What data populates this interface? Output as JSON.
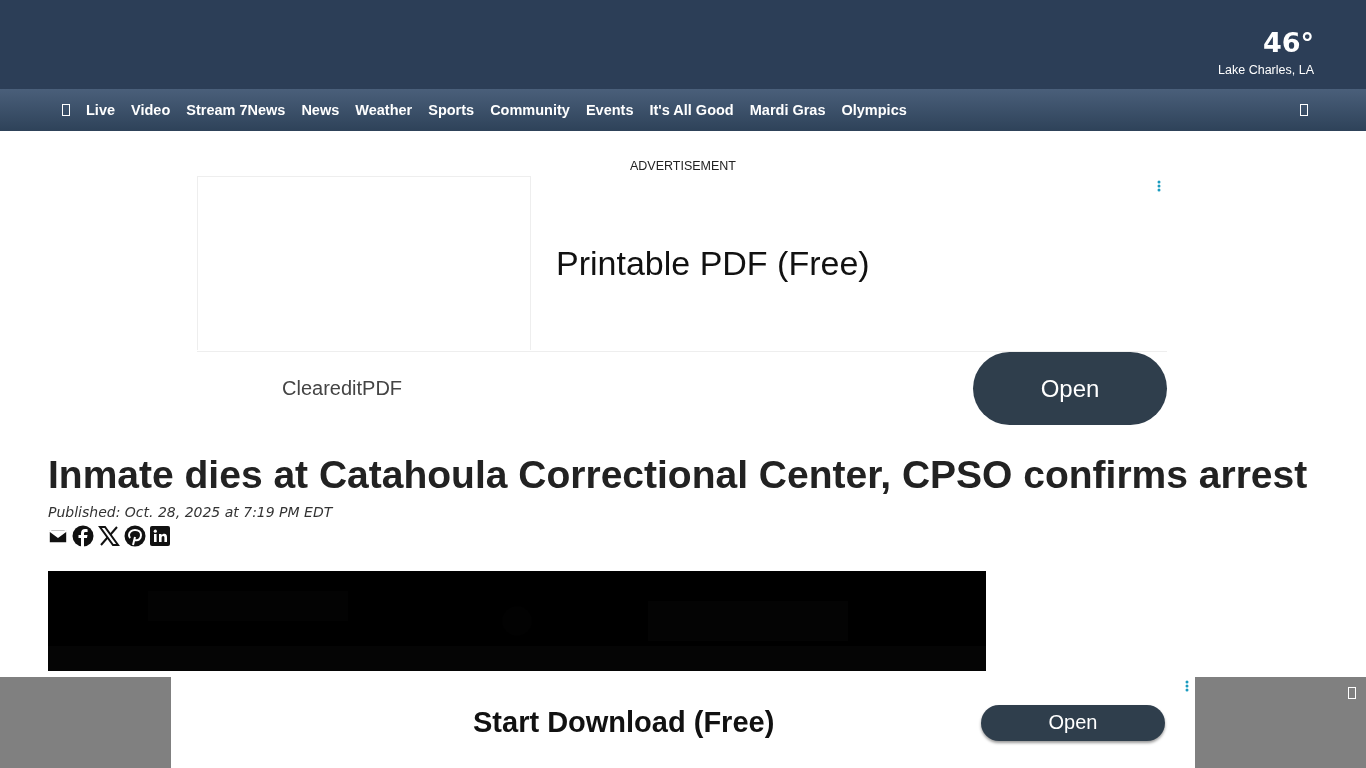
{
  "weather": {
    "temperature": "46°",
    "location": "Lake Charles, LA"
  },
  "nav": {
    "items": [
      "Live",
      "Video",
      "Stream 7News",
      "News",
      "Weather",
      "Sports",
      "Community",
      "Events",
      "It's All Good",
      "Mardi Gras",
      "Olympics"
    ]
  },
  "top_ad": {
    "label": "ADVERTISEMENT",
    "headline": "Printable PDF (Free)",
    "advertiser": "CleareditPDF",
    "button": "Open"
  },
  "article": {
    "headline": "Inmate dies at Catahoula Correctional Center, CPSO confirms arrest",
    "published": "Published: Oct. 28, 2025 at 7:19 PM EDT"
  },
  "bottom_ad": {
    "headline": "Start Download (Free)",
    "button": "Open"
  }
}
